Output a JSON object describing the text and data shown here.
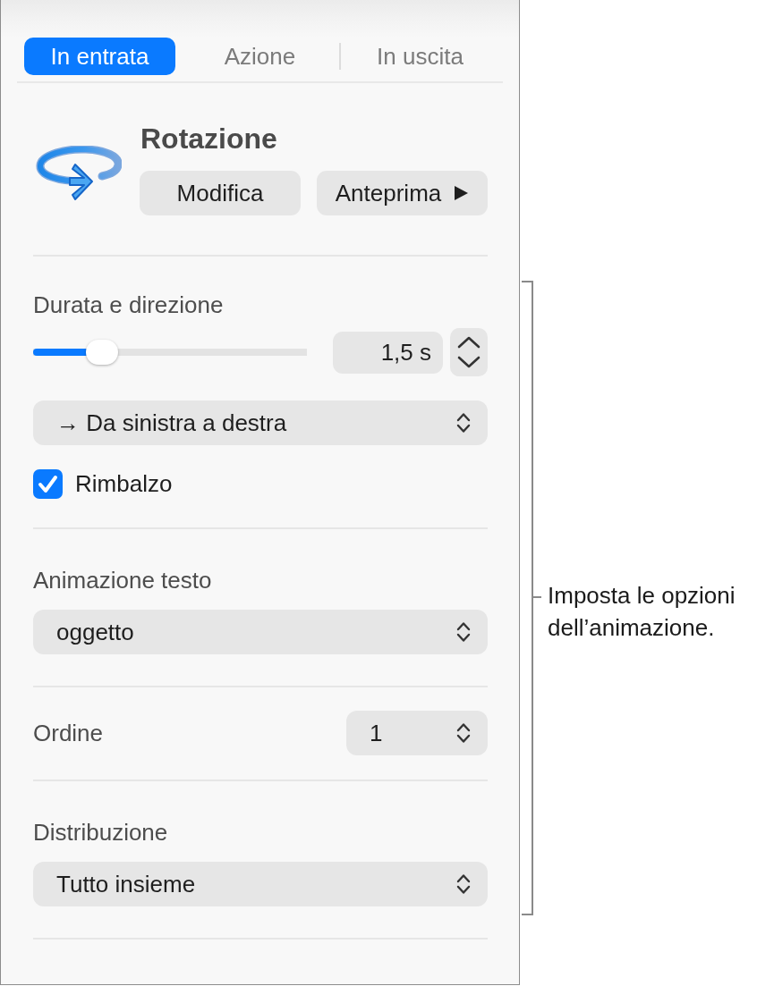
{
  "tabs": [
    {
      "label": "In entrata",
      "selected": true
    },
    {
      "label": "Azione",
      "selected": false
    },
    {
      "label": "In uscita",
      "selected": false
    }
  ],
  "effect": {
    "title": "Rotazione",
    "buttons": [
      {
        "kind": "edit",
        "label": "Modifica"
      },
      {
        "kind": "preview",
        "label": "Anteprima"
      }
    ]
  },
  "sections": [
    {
      "kind": "duration",
      "label": "Durata e direzione",
      "level": 0.25,
      "value": "1,5 s",
      "direction": "→ Da sinistra a destra",
      "checkbox": {
        "label": "Rimbalzo",
        "checked": true
      }
    },
    {
      "kind": "popup",
      "label": "Animazione testo",
      "value": "oggetto"
    },
    {
      "kind": "inline_popup",
      "label": "Ordine",
      "value": "1"
    },
    {
      "kind": "popup",
      "label": "Distribuzione",
      "value": "Tutto insieme"
    }
  ],
  "callout": {
    "text": "Imposta le opzioni dell’animazione."
  }
}
